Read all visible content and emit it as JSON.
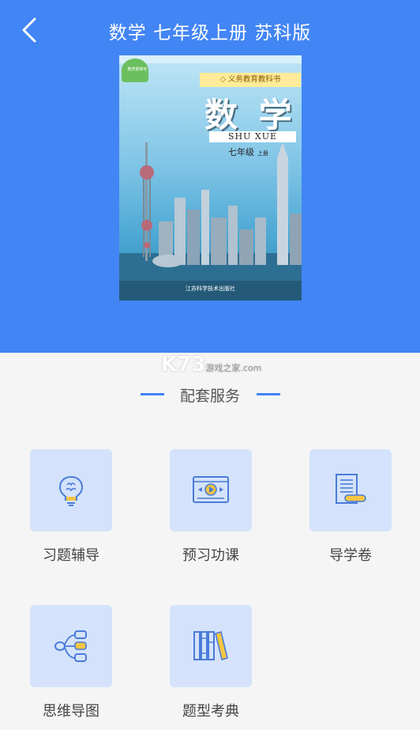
{
  "header": {
    "title": "数学 七年级上册 苏科版",
    "back_icon": "chevron-left-icon",
    "bg_color": "#4285f4"
  },
  "cover": {
    "series": "义务教育教科书",
    "title": "数 学",
    "pinyin": "SHU XUE",
    "grade": "七年级",
    "volume": "上册",
    "publisher": "江苏科学技术出版社",
    "badge": "教育部审定"
  },
  "watermark": {
    "brand": "K73",
    "sub": "游戏之家",
    "domain": ".com"
  },
  "section": {
    "title": "配套服务",
    "accent_color": "#4285f4"
  },
  "services": [
    {
      "label": "习题辅导",
      "icon": "lightbulb-brain-icon"
    },
    {
      "label": "预习功课",
      "icon": "video-player-icon"
    },
    {
      "label": "导学卷",
      "icon": "scroll-document-icon"
    },
    {
      "label": "思维导图",
      "icon": "mind-map-icon"
    },
    {
      "label": "题型考典",
      "icon": "books-icon"
    }
  ]
}
